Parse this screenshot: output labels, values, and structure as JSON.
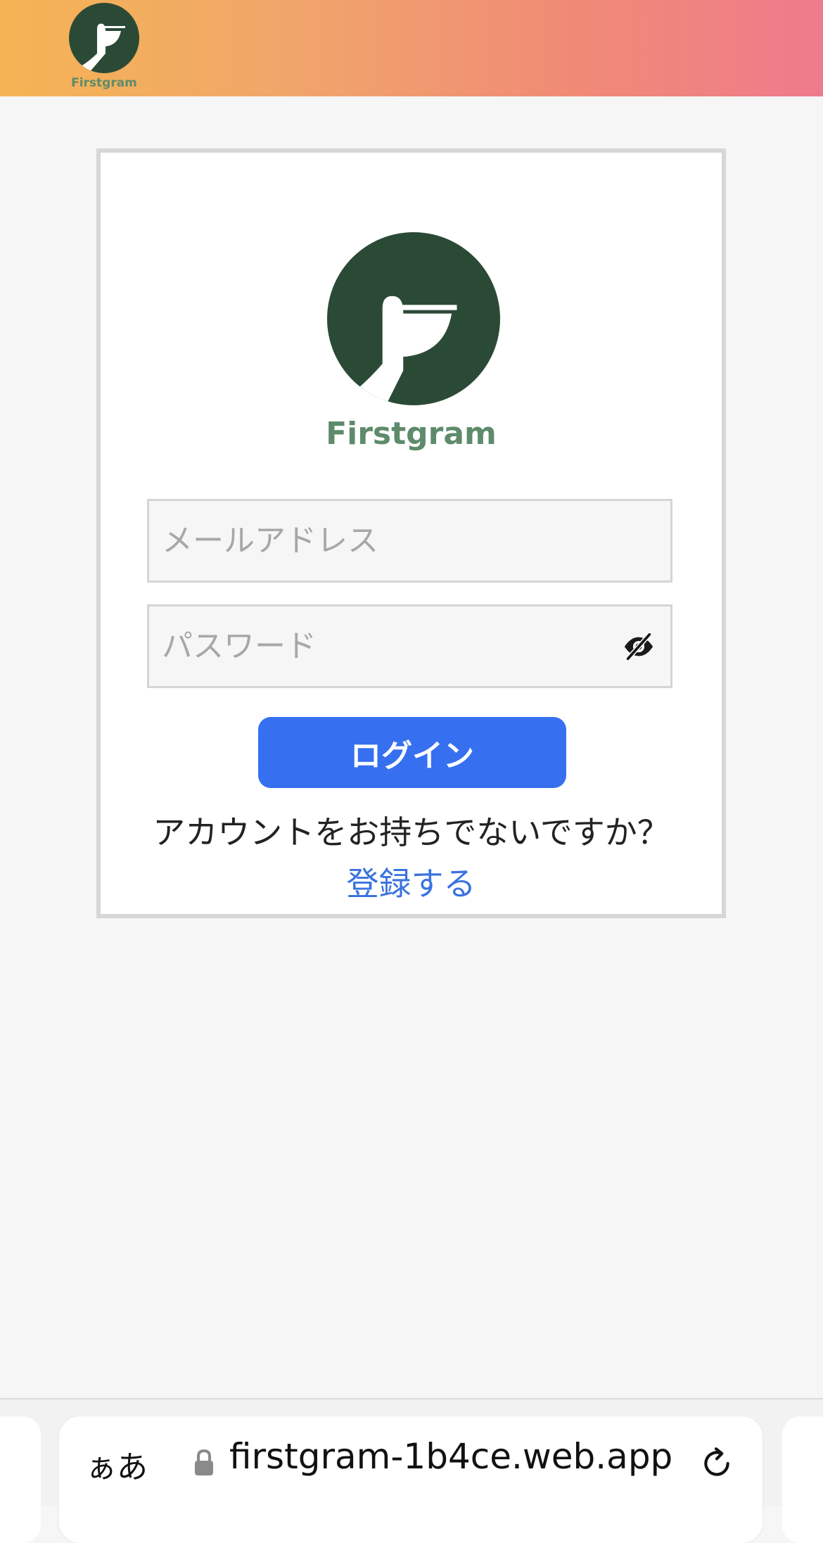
{
  "header": {
    "logo_text": "Firstgram"
  },
  "login_card": {
    "brand_name": "Firstgram",
    "email_placeholder": "メールアドレス",
    "password_placeholder": "パスワード",
    "login_label": "ログイン",
    "no_account_text": "アカウントをお持ちでないですか？",
    "register_label": "登録する"
  },
  "browser_bar": {
    "aa_label": "ぁあ",
    "url": "firstgram-1b4ce.web.app"
  },
  "icons": {
    "header_logo": "pelican-logo-icon",
    "main_logo": "pelican-logo-icon",
    "password_toggle": "eye-slash-icon",
    "lock": "lock-icon",
    "reload": "reload-icon"
  },
  "colors": {
    "header_gradient_start": "#f5b454",
    "header_gradient_end": "#ee7b8c",
    "logo_green": "#2b4a36",
    "brand_green": "#5e8b6b",
    "button_blue": "#3670f0",
    "link_blue": "#3b73df"
  }
}
